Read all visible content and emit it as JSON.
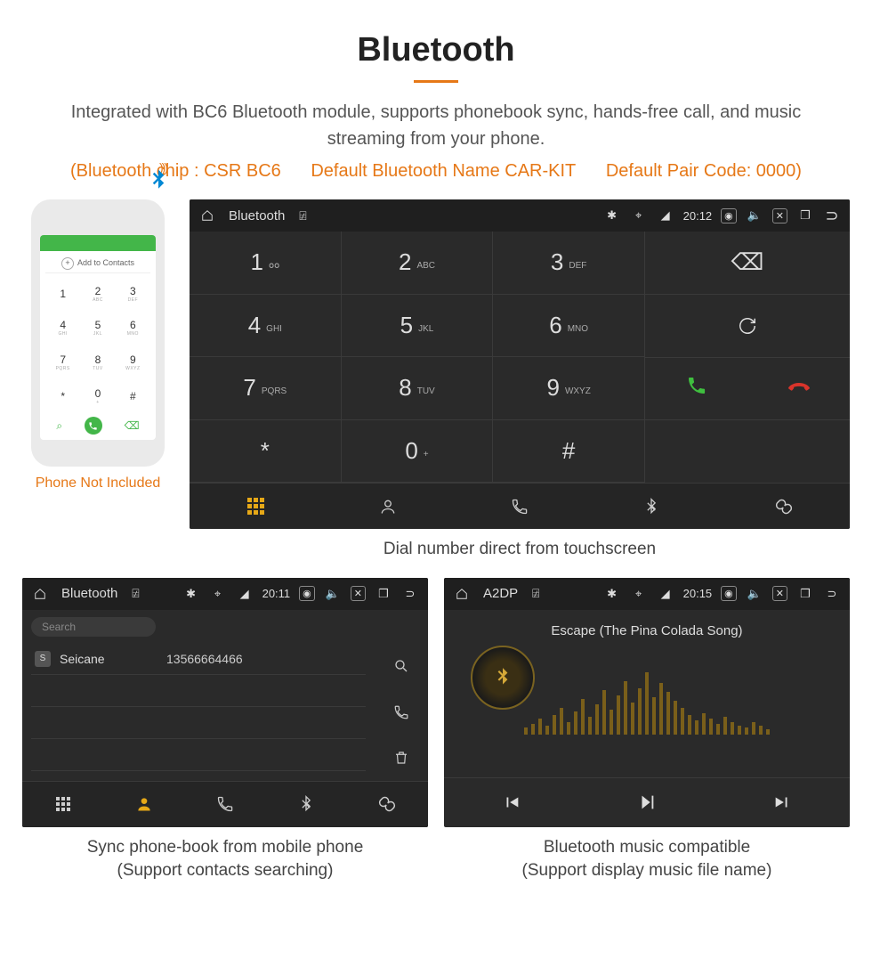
{
  "header": {
    "title": "Bluetooth",
    "description": "Integrated with BC6 Bluetooth module, supports phonebook sync, hands-free call, and music streaming from your phone.",
    "spec_chip": "(Bluetooth chip : CSR BC6",
    "spec_name": "Default Bluetooth Name CAR-KIT",
    "spec_code": "Default Pair Code: 0000)"
  },
  "phone": {
    "add_contacts": "Add to Contacts",
    "keys": [
      {
        "n": "1",
        "l": ""
      },
      {
        "n": "2",
        "l": "ABC"
      },
      {
        "n": "3",
        "l": "DEF"
      },
      {
        "n": "4",
        "l": "GHI"
      },
      {
        "n": "5",
        "l": "JKL"
      },
      {
        "n": "6",
        "l": "MNO"
      },
      {
        "n": "7",
        "l": "PQRS"
      },
      {
        "n": "8",
        "l": "TUV"
      },
      {
        "n": "9",
        "l": "WXYZ"
      },
      {
        "n": "*",
        "l": ""
      },
      {
        "n": "0",
        "l": "+"
      },
      {
        "n": "#",
        "l": ""
      }
    ],
    "caption": "Phone Not Included"
  },
  "dialer": {
    "status": {
      "title": "Bluetooth",
      "time": "20:12"
    },
    "keys": [
      {
        "n": "1",
        "l": "օօ"
      },
      {
        "n": "2",
        "l": "ABC"
      },
      {
        "n": "3",
        "l": "DEF"
      },
      {
        "n": "4",
        "l": "GHI"
      },
      {
        "n": "5",
        "l": "JKL"
      },
      {
        "n": "6",
        "l": "MNO"
      },
      {
        "n": "7",
        "l": "PQRS"
      },
      {
        "n": "8",
        "l": "TUV"
      },
      {
        "n": "9",
        "l": "WXYZ"
      },
      {
        "n": "*",
        "l": ""
      },
      {
        "n": "0",
        "l": "+"
      },
      {
        "n": "#",
        "l": ""
      }
    ],
    "caption": "Dial number direct from touchscreen"
  },
  "contacts": {
    "status": {
      "title": "Bluetooth",
      "time": "20:11"
    },
    "search_placeholder": "Search",
    "entry": {
      "badge": "S",
      "name": "Seicane",
      "number": "13566664466"
    },
    "caption_l1": "Sync phone-book from mobile phone",
    "caption_l2": "(Support contacts searching)"
  },
  "music": {
    "status": {
      "title": "A2DP",
      "time": "20:15"
    },
    "song": "Escape (The Pina Colada Song)",
    "viz_heights": [
      8,
      12,
      18,
      10,
      22,
      30,
      14,
      26,
      40,
      20,
      34,
      50,
      28,
      44,
      60,
      36,
      52,
      70,
      42,
      58,
      48,
      38,
      30,
      22,
      16,
      24,
      18,
      12,
      20,
      14,
      10,
      8,
      14,
      10,
      6
    ],
    "caption_l1": "Bluetooth music compatible",
    "caption_l2": "(Support display music file name)"
  }
}
